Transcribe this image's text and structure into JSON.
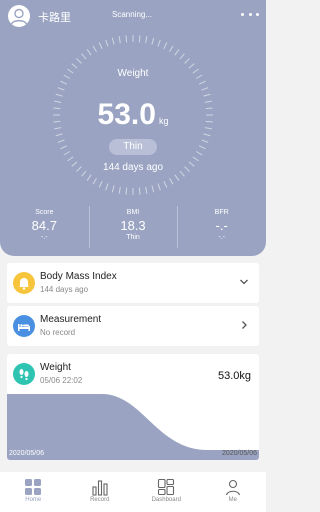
{
  "header": {
    "user_name": "卡路里",
    "scan_status": "Scanning..."
  },
  "gauge": {
    "label": "Weight",
    "value": "53.0",
    "unit": "kg",
    "badge": "Thin",
    "subtext": "144 days ago"
  },
  "stats": [
    {
      "label": "Score",
      "value": "84.7",
      "tag": "-.-"
    },
    {
      "label": "BMI",
      "value": "18.3",
      "tag": "Thin"
    },
    {
      "label": "BFR",
      "value": "-.-",
      "tag": "-.-"
    }
  ],
  "cards": {
    "bmi": {
      "title": "Body Mass Index",
      "subtitle": "144 days ago",
      "icon": "bell-icon",
      "color": "#f7c53b"
    },
    "measurement": {
      "title": "Measurement",
      "subtitle": "No record",
      "icon": "bed-icon",
      "color": "#4a90e2"
    },
    "weight": {
      "title": "Weight",
      "subtitle": "05/06 22:02",
      "value": "53.0kg",
      "icon": "footprints-icon",
      "color": "#2fc4b2"
    }
  },
  "chart_data": {
    "type": "area",
    "x_start_label": "2020/05/06",
    "x_end_label": "2020/05/06",
    "fill_color": "#9aa4c2"
  },
  "nav": [
    {
      "label": "Home",
      "icon": "grid-icon",
      "active": true
    },
    {
      "label": "Record",
      "icon": "bar-chart-icon",
      "active": false
    },
    {
      "label": "Dashboard",
      "icon": "dashboard-icon",
      "active": false
    },
    {
      "label": "Me",
      "icon": "person-icon",
      "active": false
    }
  ]
}
